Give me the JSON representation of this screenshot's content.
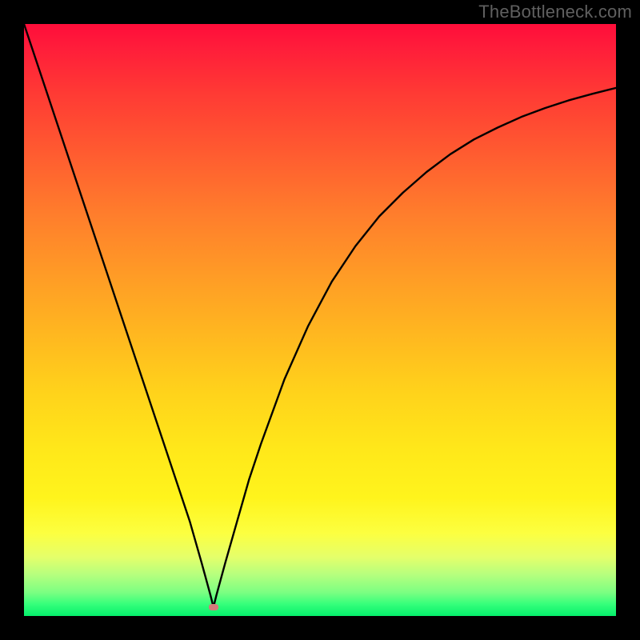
{
  "watermark": "TheBottleneck.com",
  "colors": {
    "page_bg": "#000000",
    "curve": "#000000",
    "dip_marker": "#d47a7a",
    "gradient_top": "#ff0d3a",
    "gradient_bottom": "#05ef6b"
  },
  "chart_data": {
    "type": "line",
    "title": "",
    "xlabel": "",
    "ylabel": "",
    "xlim": [
      0,
      100
    ],
    "ylim": [
      0,
      100
    ],
    "grid": false,
    "legend": false,
    "notes": "V-shaped curve on a vertical red→green gradient. Left branch is nearly straight from top-left to the dip; right branch rises with diminishing slope. Dip marked by a small rounded marker near the bottom.",
    "dip": {
      "x": 32,
      "y": 1.5
    },
    "series": [
      {
        "name": "curve",
        "x": [
          0,
          4,
          8,
          12,
          16,
          20,
          24,
          28,
          30,
          31.5,
          32,
          32.5,
          34,
          36,
          38,
          40,
          44,
          48,
          52,
          56,
          60,
          64,
          68,
          72,
          76,
          80,
          84,
          88,
          92,
          96,
          100
        ],
        "y": [
          100,
          88,
          76,
          64,
          52,
          40,
          28,
          16,
          9,
          3.5,
          1.5,
          3.5,
          9,
          16,
          23,
          29,
          40,
          49,
          56.5,
          62.5,
          67.5,
          71.5,
          75,
          78,
          80.5,
          82.5,
          84.3,
          85.8,
          87.1,
          88.2,
          89.2
        ]
      }
    ]
  }
}
